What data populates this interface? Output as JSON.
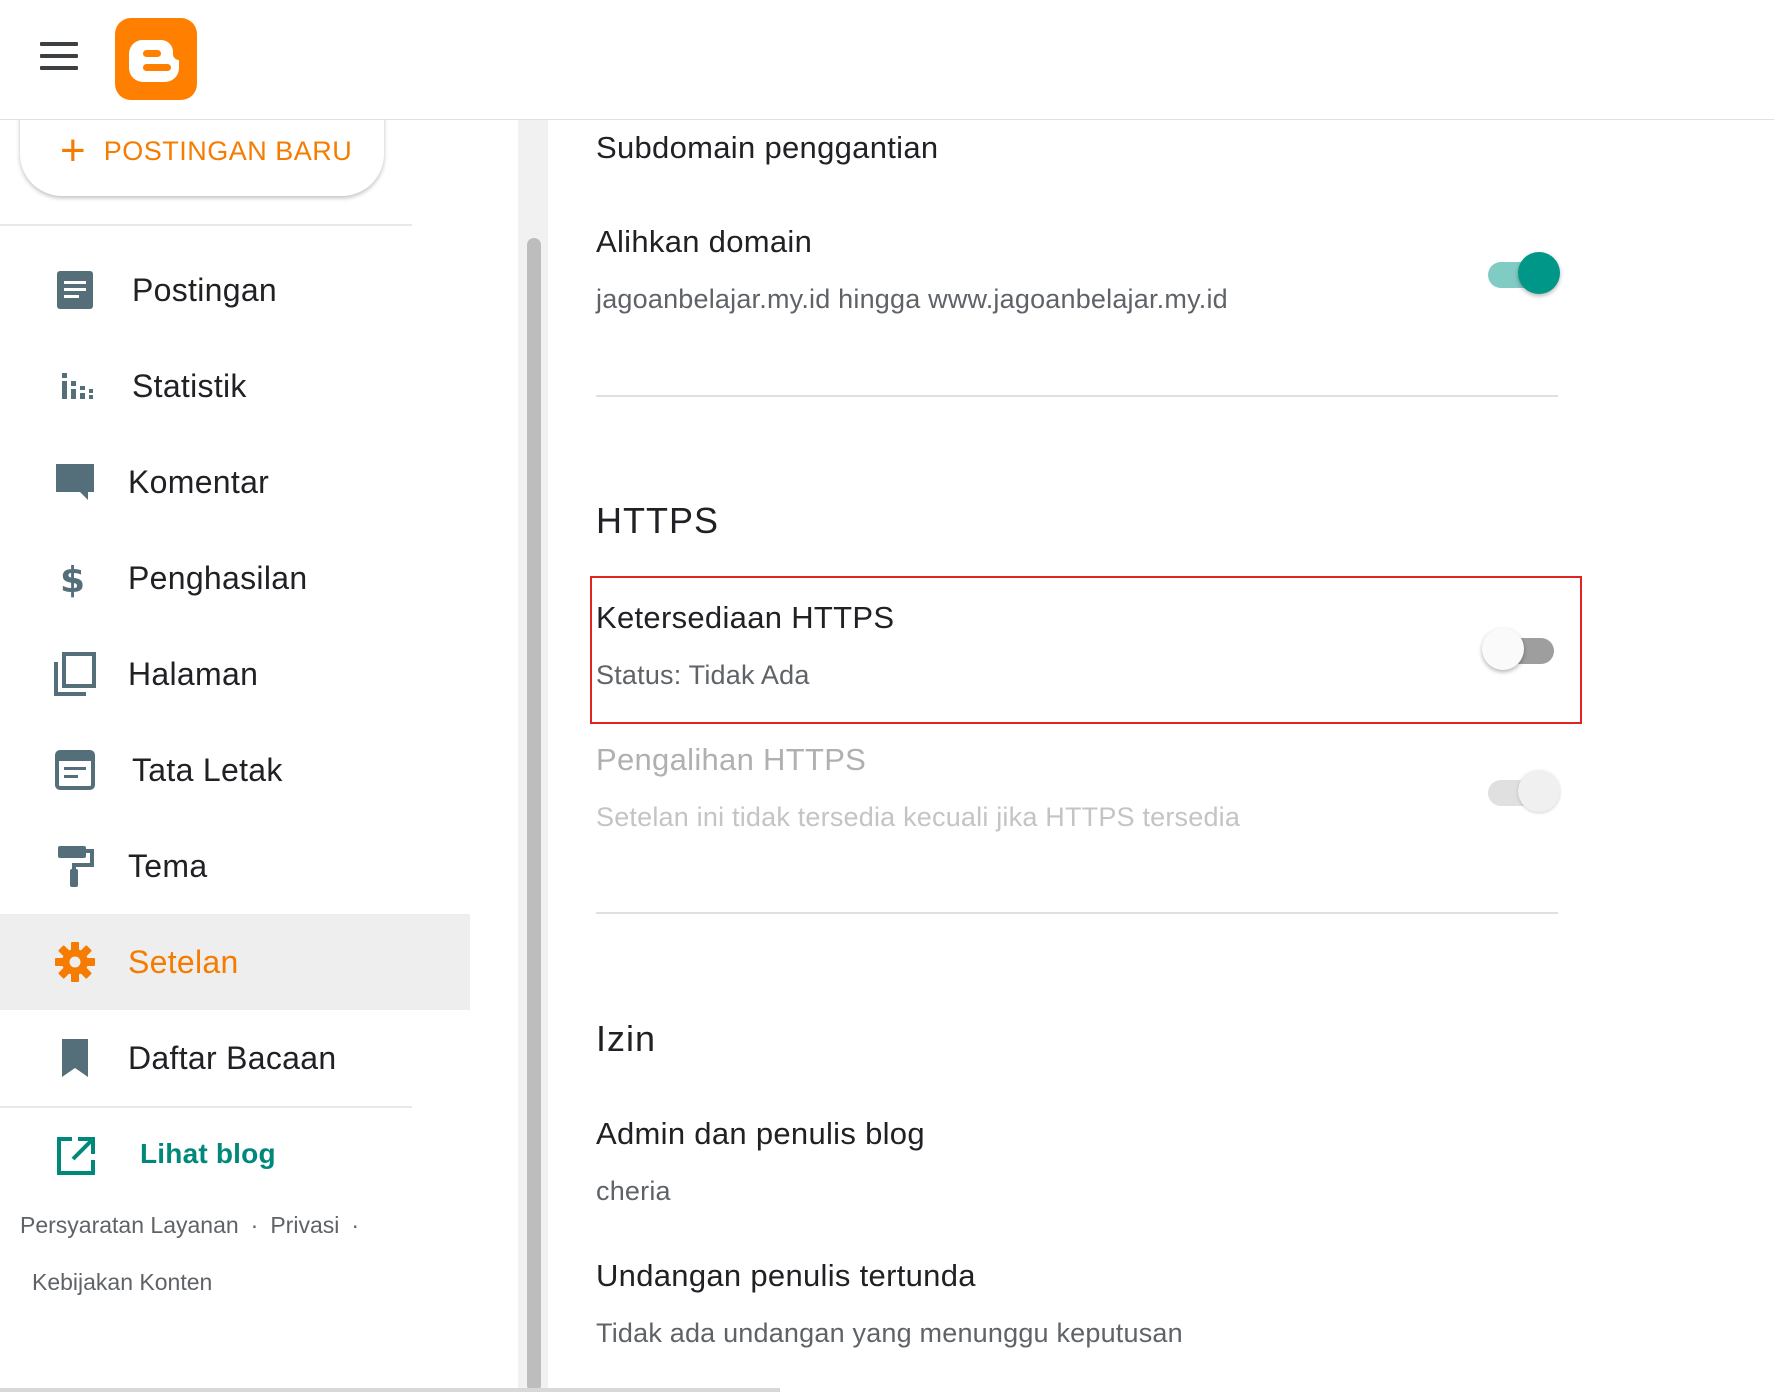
{
  "header": {
    "menu_icon": "hamburger-menu-icon",
    "logo_icon": "blogger-logo-icon",
    "brand_color": "#f57c00"
  },
  "sidebar": {
    "new_post_label": "POSTINGAN BARU",
    "items": [
      {
        "label": "Postingan",
        "icon": "posts-icon"
      },
      {
        "label": "Statistik",
        "icon": "stats-icon"
      },
      {
        "label": "Komentar",
        "icon": "comment-icon"
      },
      {
        "label": "Penghasilan",
        "icon": "dollar-icon"
      },
      {
        "label": "Halaman",
        "icon": "pages-icon"
      },
      {
        "label": "Tata Letak",
        "icon": "layout-icon"
      },
      {
        "label": "Tema",
        "icon": "paint-roller-icon"
      },
      {
        "label": "Setelan",
        "icon": "gear-icon",
        "active": true
      },
      {
        "label": "Daftar Bacaan",
        "icon": "bookmark-icon"
      }
    ],
    "view_blog_label": "Lihat blog",
    "footer": {
      "terms": "Persyaratan Layanan",
      "privacy": "Privasi",
      "content_policy": "Kebijakan Konten",
      "separator": "·"
    }
  },
  "settings": {
    "replacement_subdomain": {
      "title": "Subdomain penggantian"
    },
    "redirect_domain": {
      "title": "Alihkan domain",
      "subtitle": "jagoanbelajar.my.id hingga www.jagoanbelajar.my.id",
      "enabled": true
    },
    "https_section": {
      "heading": "HTTPS",
      "availability": {
        "title": "Ketersediaan HTTPS",
        "subtitle": "Status: Tidak Ada",
        "enabled": false
      },
      "redirect": {
        "title": "Pengalihan HTTPS",
        "subtitle": "Setelan ini tidak tersedia kecuali jika HTTPS tersedia",
        "enabled": true,
        "disabled": true
      }
    },
    "permissions_section": {
      "heading": "Izin",
      "admins": {
        "title": "Admin dan penulis blog",
        "subtitle": "cheria"
      },
      "pending": {
        "title": "Undangan penulis tertunda",
        "subtitle": "Tidak ada undangan yang menunggu keputusan"
      }
    }
  },
  "colors": {
    "accent_orange": "#f57c00",
    "toggle_on": "#009688",
    "link_teal": "#00897b",
    "highlight_red": "#e02424"
  }
}
